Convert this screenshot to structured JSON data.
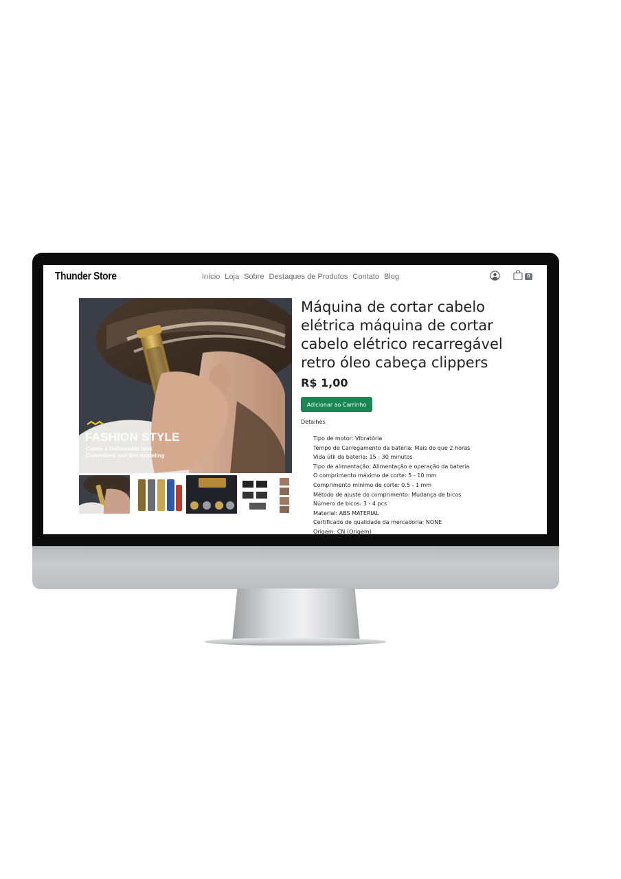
{
  "header": {
    "brand": "Thunder Store",
    "nav": [
      "Início",
      "Loja",
      "Sobre",
      "Destaques de Produtos",
      "Contato",
      "Blog"
    ],
    "user_icon": "user-circle-icon",
    "cart_icon": "shopping-bag-icon",
    "cart_count": "0"
  },
  "gallery": {
    "main_overlay_title": "FASHION STYLE",
    "main_overlay_subtitle_1": "Create a fashionable look",
    "main_overlay_subtitle_2": "Convenient and fast modeling",
    "thumbnails": [
      "thumbnail-haircut",
      "thumbnail-clipper-colors",
      "thumbnail-accessories",
      "thumbnail-combs"
    ]
  },
  "product": {
    "title": "Máquina de cortar cabelo elétrica máquina de cortar cabelo elétrico recarregável retro óleo cabeça clippers",
    "price": "R$ 1,00",
    "add_to_cart": "Adicionar ao Carrinho",
    "details_label": "Detalhes",
    "specs": [
      "Tipo de motor: Vibratória",
      "Tempo de Carregamento da bateria: Mais do que 2 horas",
      "Vida útil da bateria: 15 - 30 minutos",
      "Tipo de alimentação: Alimentação e operação da bateria",
      "O comprimento máximo de corte: 5 - 10 mm",
      "Comprimento mínimo de corte: 0.5 - 1 mm",
      "Método de ajuste do comprimento: Mudança de bicos",
      "Número de bicos: 3 - 4 pcs",
      "Material: ABS MATERIAL",
      "Certificado de qualidade da mercadoria: NONE",
      "Origem: CN (Origem)"
    ]
  },
  "colors": {
    "button": "#198754",
    "badge": "#6c757d",
    "bezel": "#0c0c0c"
  }
}
